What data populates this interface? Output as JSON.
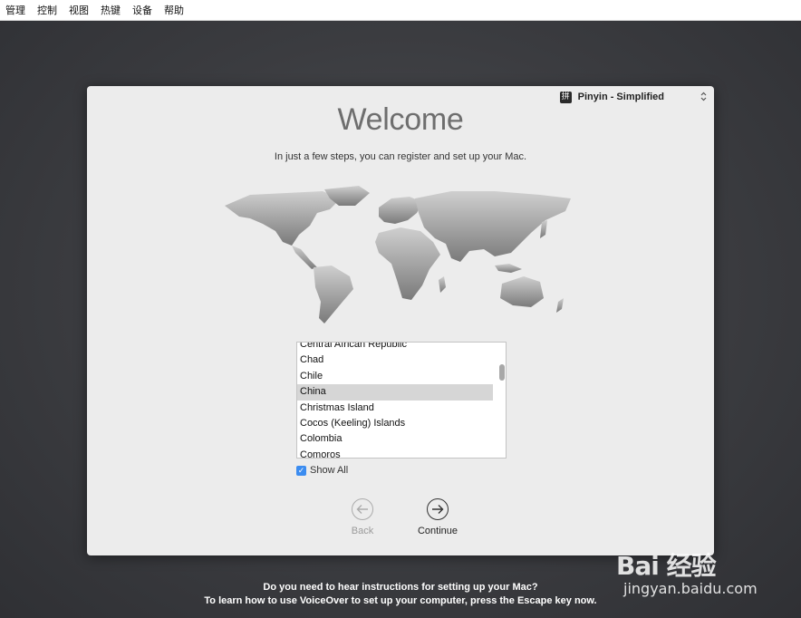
{
  "menubar": {
    "items": [
      "管理",
      "控制",
      "视图",
      "热键",
      "设备",
      "帮助"
    ]
  },
  "input_source": {
    "icon_char": "拼",
    "label": "Pinyin - Simplified",
    "stepper_glyph": "⌃⌄"
  },
  "welcome": {
    "title": "Welcome",
    "subtitle": "In just a few steps, you can register and set up your Mac."
  },
  "country_list": {
    "items": [
      "Central African Republic",
      "Chad",
      "Chile",
      "China",
      "Christmas Island",
      "Cocos (Keeling) Islands",
      "Colombia",
      "Comoros"
    ],
    "selected": "China"
  },
  "show_all": {
    "label": "Show All",
    "checked": true
  },
  "nav": {
    "back_label": "Back",
    "continue_label": "Continue"
  },
  "voiceover": {
    "line1": "Do you need to hear instructions for setting up your Mac?",
    "line2": "To learn how to use VoiceOver to set up your computer, press the Escape key now."
  },
  "watermark": {
    "brand": "Bai 经验",
    "url": "jingyan.baidu.com"
  }
}
